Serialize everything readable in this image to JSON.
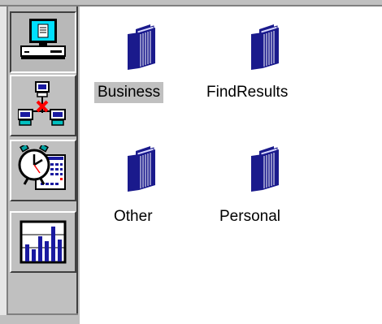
{
  "sidebar": {
    "buttons": [
      {
        "name": "My Computer",
        "icon": "computer-icon",
        "state": "pressed"
      },
      {
        "name": "Network",
        "icon": "network-icon",
        "state": "raised"
      },
      {
        "name": "Scheduler",
        "icon": "clock-calendar-icon",
        "state": "raised"
      },
      {
        "name": "Statistics",
        "icon": "bar-chart-icon",
        "state": "raised"
      }
    ]
  },
  "folders": [
    {
      "label": "Business",
      "selected": true
    },
    {
      "label": "FindResults",
      "selected": false
    },
    {
      "label": "Other",
      "selected": false
    },
    {
      "label": "Personal",
      "selected": false
    }
  ],
  "colors": {
    "book_dark": "#1a1a8c",
    "book_page": "#d8d8ff",
    "selection_bg": "#c0c0c0",
    "screen_cyan": "#00e0ff"
  }
}
